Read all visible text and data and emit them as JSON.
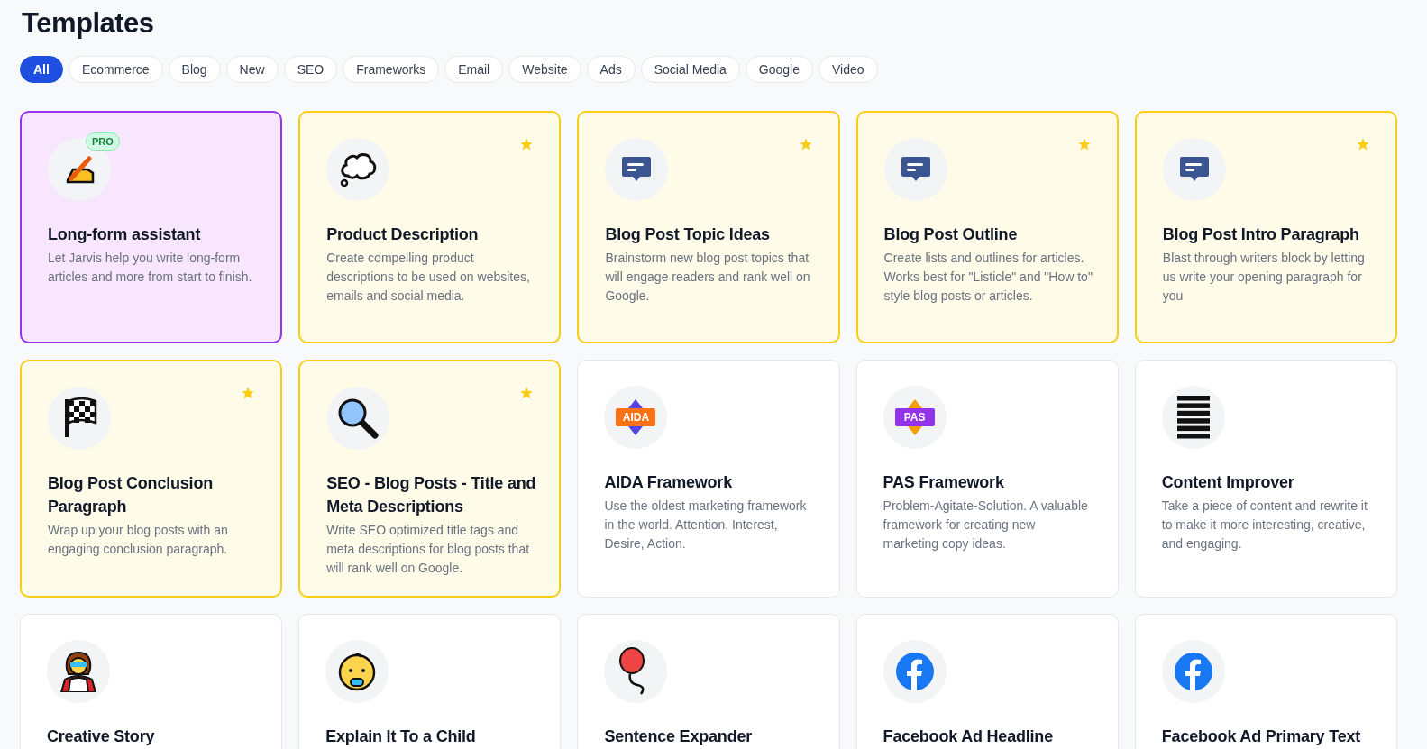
{
  "title": "Templates",
  "filters": [
    {
      "label": "All",
      "selected": true
    },
    {
      "label": "Ecommerce",
      "selected": false
    },
    {
      "label": "Blog",
      "selected": false
    },
    {
      "label": "New",
      "selected": false
    },
    {
      "label": "SEO",
      "selected": false
    },
    {
      "label": "Frameworks",
      "selected": false
    },
    {
      "label": "Email",
      "selected": false
    },
    {
      "label": "Website",
      "selected": false
    },
    {
      "label": "Ads",
      "selected": false
    },
    {
      "label": "Social Media",
      "selected": false
    },
    {
      "label": "Google",
      "selected": false
    },
    {
      "label": "Video",
      "selected": false
    }
  ],
  "cards": [
    {
      "kind": "pro",
      "badge": "PRO",
      "starred": false,
      "title": "Long-form assistant",
      "description": "Let Jarvis help you write long-form articles and more from start to finish."
    },
    {
      "kind": "featured",
      "starred": true,
      "title": "Product Description",
      "description": "Create compelling product descriptions to be used on websites, emails and social media."
    },
    {
      "kind": "featured",
      "starred": true,
      "title": "Blog Post Topic Ideas",
      "description": "Brainstorm new blog post topics that will engage readers and rank well on Google."
    },
    {
      "kind": "featured",
      "starred": true,
      "title": "Blog Post Outline",
      "description": "Create lists and outlines for articles. Works best for \"Listicle\" and \"How to\" style blog posts or articles."
    },
    {
      "kind": "featured",
      "starred": true,
      "title": "Blog Post Intro Paragraph",
      "description": "Blast through writers block by letting us write your opening paragraph for you"
    },
    {
      "kind": "featured",
      "starred": true,
      "title": "Blog Post Conclusion Paragraph",
      "description": "Wrap up your blog posts with an engaging conclusion paragraph."
    },
    {
      "kind": "featured",
      "starred": true,
      "title": "SEO - Blog Posts - Title and Meta Descriptions",
      "description": "Write SEO optimized title tags and meta descriptions for blog posts that will rank well on Google."
    },
    {
      "kind": "plain",
      "icon_label": "AIDA",
      "starred": false,
      "title": "AIDA Framework",
      "description": "Use the oldest marketing framework in the world. Attention, Interest, Desire, Action."
    },
    {
      "kind": "plain",
      "icon_label": "PAS",
      "starred": false,
      "title": "PAS Framework",
      "description": "Problem-Agitate-Solution. A valuable framework for creating new marketing copy ideas."
    },
    {
      "kind": "plain",
      "starred": false,
      "title": "Content Improver",
      "description": "Take a piece of content and rewrite it to make it more interesting, creative, and engaging."
    },
    {
      "kind": "plain",
      "starred": false,
      "title": "Creative Story"
    },
    {
      "kind": "plain",
      "starred": false,
      "title": "Explain It To a Child"
    },
    {
      "kind": "plain",
      "starred": false,
      "title": "Sentence Expander"
    },
    {
      "kind": "plain",
      "starred": false,
      "title": "Facebook Ad Headline"
    },
    {
      "kind": "plain",
      "starred": false,
      "title": "Facebook Ad Primary Text"
    }
  ]
}
